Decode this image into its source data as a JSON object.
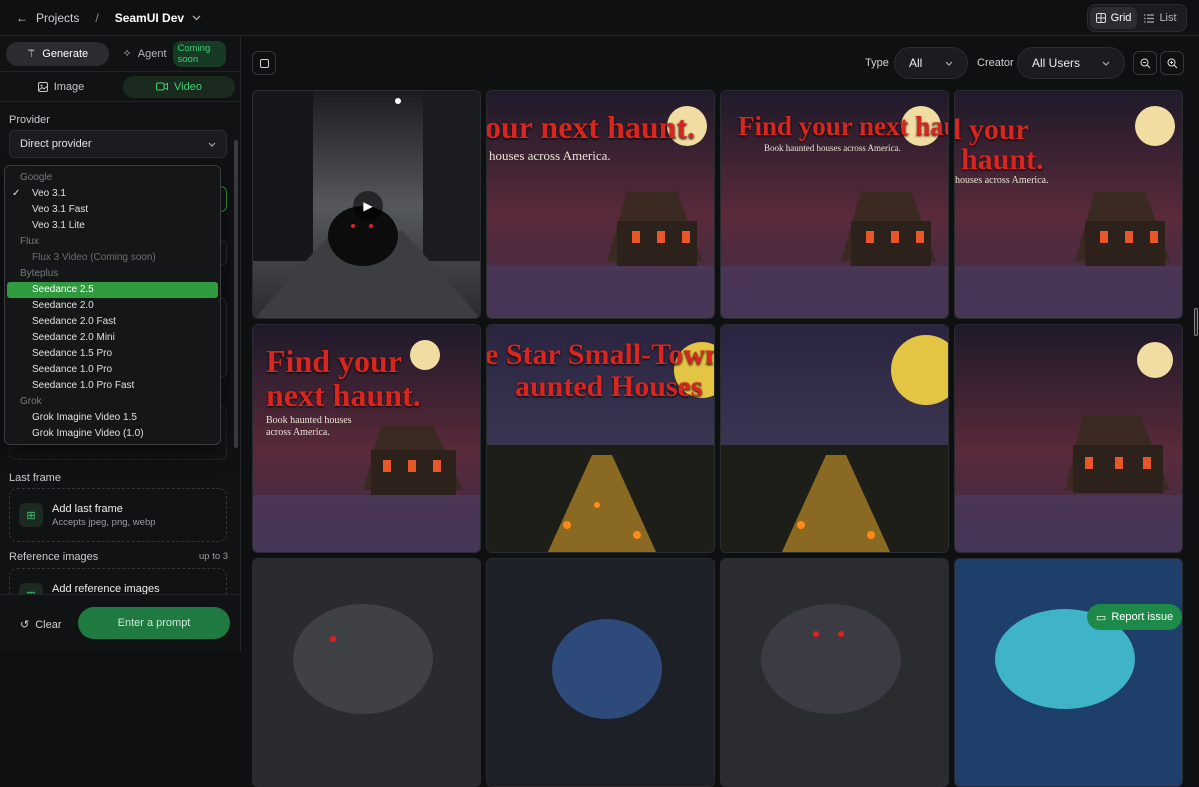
{
  "topbar": {
    "back_label": "Projects",
    "separator": "/",
    "project_name": "SeamUI Dev",
    "view_grid": "Grid",
    "view_list": "List"
  },
  "sidebar": {
    "mode_generate": "Generate",
    "mode_agent": "Agent",
    "agent_badge": "Coming soon",
    "tab_image": "Image",
    "tab_video": "Video",
    "provider_label": "Provider",
    "provider_value": "Direct provider",
    "last_frame_label": "Last frame",
    "last_frame_title": "Add last frame",
    "last_frame_hint": "Accepts jpeg, png, webp",
    "reference_label": "Reference images",
    "reference_limit": "up to 3",
    "reference_title": "Add reference images",
    "clear_label": "Clear",
    "prompt_button": "Enter a prompt"
  },
  "model_dropdown": {
    "google_group": "Google",
    "veo31": "Veo 3.1",
    "veo31_fast": "Veo 3.1 Fast",
    "veo31_lite": "Veo 3.1 Lite",
    "flux_group": "Flux",
    "flux3": "Flux 3 Video (Coming soon)",
    "byteplus_group": "Byteplus",
    "seedance25": "Seedance 2.5",
    "seedance20": "Seedance 2.0",
    "seedance20_fast": "Seedance 2.0 Fast",
    "seedance20_mini": "Seedance 2.0 Mini",
    "seedance15_pro": "Seedance 1.5 Pro",
    "seedance10_pro": "Seedance 1.0 Pro",
    "seedance10_pro_fast": "Seedance 1.0 Pro Fast",
    "grok_group": "Grok",
    "grok15": "Grok Imagine Video 1.5",
    "grok10": "Grok Imagine Video (1.0)",
    "selected": "Veo 3.1",
    "highlighted": "Seedance 2.5"
  },
  "toolbar": {
    "type_label": "Type",
    "type_value": "All",
    "creator_label": "Creator",
    "creator_value": "All Users"
  },
  "tiles": {
    "t2_line1": "our next haunt.",
    "t2_line2": "houses across America.",
    "t3_line1": "Find your next haunt.",
    "t3_line2": "Book haunted houses across America.",
    "t4_line1": "l your",
    "t4_line2": "haunt.",
    "t4_line3": "houses across America.",
    "t5_line1": "Find your",
    "t5_line2": "next haunt.",
    "t5_sub1": "Book haunted houses",
    "t5_sub2": "across America.",
    "t6_line1": "e Star Small-Town",
    "t6_line2": "aunted Houses"
  },
  "report_label": "Report issue",
  "colors": {
    "accent": "#3bd06f",
    "highlight": "#2f9a3e",
    "headline_red": "#d7261f"
  }
}
